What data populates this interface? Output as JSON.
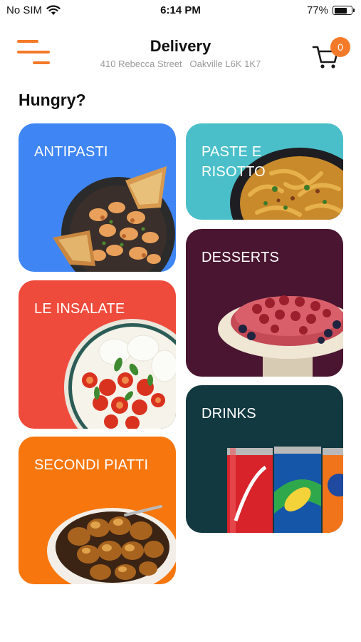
{
  "status_bar": {
    "carrier": "No SIM",
    "time": "6:14 PM",
    "battery_percent": "77%",
    "battery_level": 0.77
  },
  "header": {
    "title": "Delivery",
    "address": "410 Rebecca Street   Oakville L6K 1K7",
    "cart_count": "0"
  },
  "section_title": "Hungry?",
  "categories": [
    {
      "label": "ANTIPASTI",
      "color": "#3f86f4",
      "image": "shrimp-skillet-image"
    },
    {
      "label": "PASTE E\nRISOTTO",
      "color": "#4bbfc9",
      "image": "pasta-bowl-image"
    },
    {
      "label": "LE INSALATE",
      "color": "#ef4b3c",
      "image": "caprese-salad-image"
    },
    {
      "label": "DESSERTS",
      "color": "#4a1530",
      "image": "berry-cake-image"
    },
    {
      "label": "SECONDI PIATTI",
      "color": "#f7770e",
      "image": "roasted-potatoes-image"
    },
    {
      "label": "DRINKS",
      "color": "#123840",
      "image": "soda-cans-image"
    }
  ],
  "colors": {
    "accent": "#f47a2a"
  }
}
